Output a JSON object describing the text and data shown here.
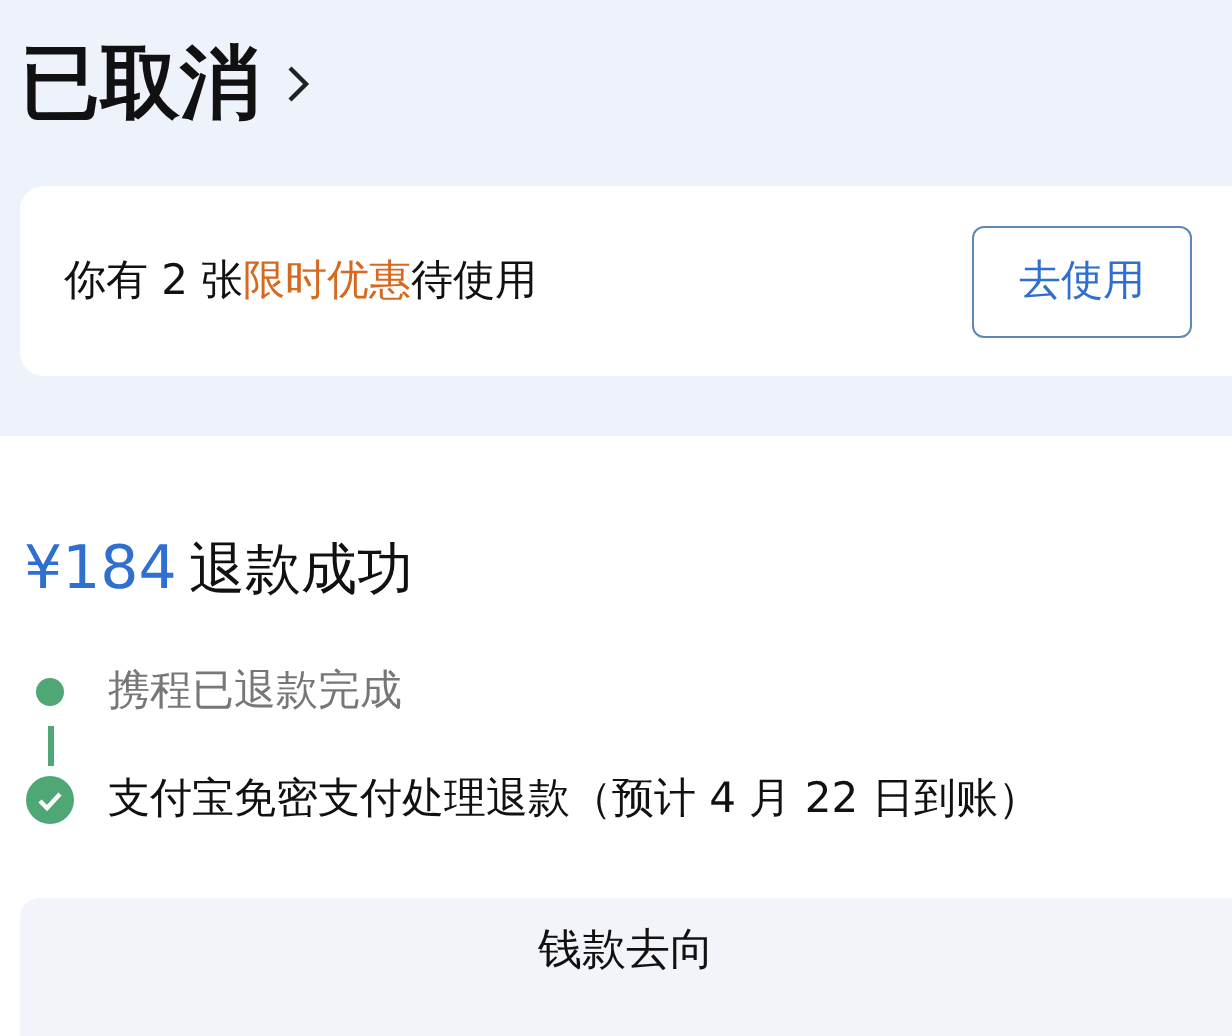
{
  "status": {
    "title": "已取消"
  },
  "coupon": {
    "parts": [
      {
        "text": "你有 2 张",
        "highlight": false
      },
      {
        "text": "限时优惠",
        "highlight": true
      },
      {
        "text": "待使用",
        "highlight": false
      }
    ],
    "button": "去使用"
  },
  "refund": {
    "amount": "¥184",
    "label": "退款成功",
    "steps": [
      {
        "text": "携程已退款完成",
        "current": false
      },
      {
        "text": "支付宝免密支付处理退款（预计 4 月 22 日到账）",
        "current": true
      }
    ]
  },
  "bottom_button": "钱款去向"
}
